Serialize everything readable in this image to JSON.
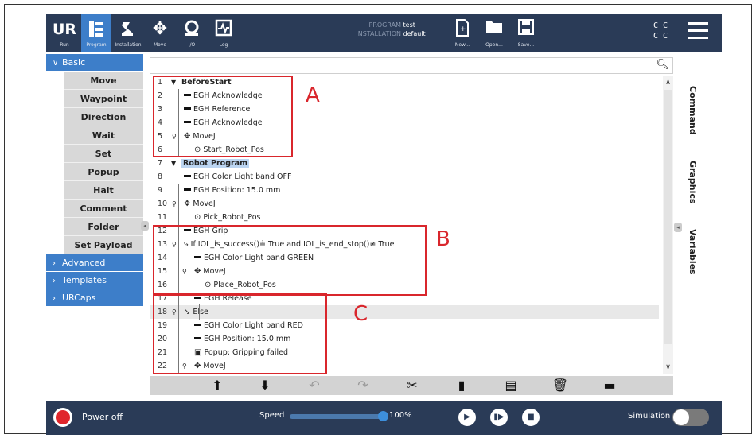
{
  "header": {
    "buttons": [
      {
        "id": "ur",
        "label": "Run",
        "icon": "ur-logo-icon"
      },
      {
        "id": "program",
        "label": "Program",
        "icon": "program-tree-icon"
      },
      {
        "id": "installation",
        "label": "Installation",
        "icon": "robot-arm-icon"
      },
      {
        "id": "move",
        "label": "Move",
        "icon": "move-arrows-icon"
      },
      {
        "id": "io",
        "label": "I/O",
        "icon": "io-icon"
      },
      {
        "id": "log",
        "label": "Log",
        "icon": "log-icon"
      }
    ],
    "program_key": "PROGRAM",
    "program_value": "test",
    "installation_key": "INSTALLATION",
    "installation_value": "default",
    "file_buttons": [
      {
        "label": "New...",
        "icon": "new-file-icon"
      },
      {
        "label": "Open...",
        "icon": "open-folder-icon"
      },
      {
        "label": "Save...",
        "icon": "save-icon"
      }
    ],
    "cc_line1": "C C",
    "cc_line2": "C C"
  },
  "left_panel": {
    "basic_label": "Basic",
    "basic_items": [
      "Move",
      "Waypoint",
      "Direction",
      "Wait",
      "Set",
      "Popup",
      "Halt",
      "Comment",
      "Folder",
      "Set Payload"
    ],
    "advanced_label": "Advanced",
    "templates_label": "Templates",
    "urcaps_label": "URCaps"
  },
  "tree": {
    "rows": [
      {
        "n": "1",
        "text": "BeforeStart",
        "kind": "section"
      },
      {
        "n": "2",
        "text": "EGH Acknowledge",
        "kind": "cmd",
        "depth": 1
      },
      {
        "n": "3",
        "text": "EGH Reference",
        "kind": "cmd",
        "depth": 1
      },
      {
        "n": "4",
        "text": "EGH Acknowledge",
        "kind": "cmd",
        "depth": 1
      },
      {
        "n": "5",
        "text": "MoveJ",
        "kind": "move",
        "depth": 1
      },
      {
        "n": "6",
        "text": "Start_Robot_Pos",
        "kind": "wp",
        "depth": 2
      },
      {
        "n": "7",
        "text": "Robot Program",
        "kind": "section"
      },
      {
        "n": "8",
        "text": "EGH Color Light band OFF",
        "kind": "cmd",
        "depth": 1
      },
      {
        "n": "9",
        "text": "EGH Position: 15.0 mm",
        "kind": "cmd",
        "depth": 1
      },
      {
        "n": "10",
        "text": "MoveJ",
        "kind": "move",
        "depth": 1
      },
      {
        "n": "11",
        "text": "Pick_Robot_Pos",
        "kind": "wp",
        "depth": 2
      },
      {
        "n": "12",
        "text": "EGH Grip",
        "kind": "cmd",
        "depth": 1
      },
      {
        "n": "13",
        "text": "If IOL_is_success()≟ True  and IOL_is_end_stop()≠ True",
        "kind": "if",
        "depth": 1
      },
      {
        "n": "14",
        "text": "EGH Color Light band GREEN",
        "kind": "cmd",
        "depth": 2
      },
      {
        "n": "15",
        "text": "MoveJ",
        "kind": "move",
        "depth": 2
      },
      {
        "n": "16",
        "text": "Place_Robot_Pos",
        "kind": "wp",
        "depth": 3
      },
      {
        "n": "17",
        "text": "EGH Release",
        "kind": "cmd",
        "depth": 2
      },
      {
        "n": "18",
        "text": "Else",
        "kind": "else",
        "depth": 1
      },
      {
        "n": "19",
        "text": "EGH Color Light band RED",
        "kind": "cmd",
        "depth": 2
      },
      {
        "n": "20",
        "text": "EGH Position: 15.0 mm",
        "kind": "cmd",
        "depth": 2
      },
      {
        "n": "21",
        "text": "Popup: Gripping failed",
        "kind": "popup",
        "depth": 2
      },
      {
        "n": "22",
        "text": "MoveJ",
        "kind": "move",
        "depth": 2
      }
    ]
  },
  "annotations": {
    "a": "A",
    "b": "B",
    "c": "C"
  },
  "right_tabs": {
    "command": "Command",
    "graphics": "Graphics",
    "variables": "Variables"
  },
  "toolbar_icons": [
    "move-up-icon",
    "move-down-icon",
    "undo-icon",
    "redo-icon",
    "cut-icon",
    "copy-icon",
    "paste-icon",
    "delete-icon",
    "suppress-icon"
  ],
  "footer": {
    "power_label": "Power off",
    "speed_label": "Speed",
    "speed_value": "100%",
    "speed_fraction": 1.0,
    "simulation_label": "Simulation",
    "simulation_on": false
  },
  "colors": {
    "header": "#2a3b57",
    "accent": "#3d7ec9",
    "annotation": "#d9262c"
  }
}
